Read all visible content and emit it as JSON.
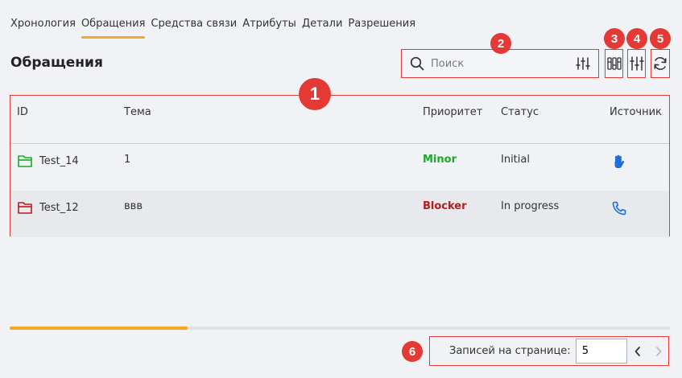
{
  "tabs": [
    {
      "label": "Хронология"
    },
    {
      "label": "Обращения",
      "active": true
    },
    {
      "label": "Средства связи"
    },
    {
      "label": "Атрибуты"
    },
    {
      "label": "Детали"
    },
    {
      "label": "Разрешения"
    }
  ],
  "page_title": "Обращения",
  "search": {
    "placeholder": "Поиск"
  },
  "table": {
    "columns": [
      "ID",
      "Тема",
      "Приоритет",
      "Статус",
      "Источник"
    ],
    "rows": [
      {
        "id": "Test_14",
        "topic": "1",
        "priority": "Minor",
        "priority_color": "#1aa928",
        "status": "Initial",
        "source_icon": "hand-icon",
        "folder_color": "#1aa928"
      },
      {
        "id": "Test_12",
        "topic": "ввв",
        "priority": "Blocker",
        "priority_color": "#b71c1c",
        "status": "In progress",
        "source_icon": "phone-icon",
        "folder_color": "#b71c1c"
      }
    ]
  },
  "scroll_progress": 0.27,
  "pager": {
    "label": "Записей на странице:",
    "page_size": "5"
  },
  "callouts": [
    "1",
    "2",
    "3",
    "4",
    "5",
    "6"
  ],
  "colors": {
    "accent": "#f5a623",
    "highlight": "#e53935",
    "link_icon": "#1e6fd9"
  }
}
